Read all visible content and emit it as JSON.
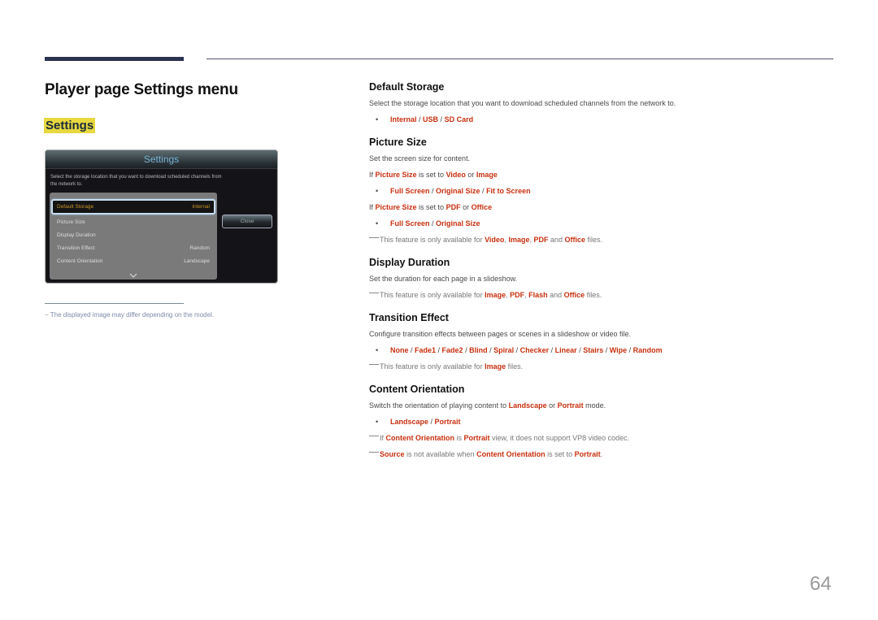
{
  "page": {
    "title": "Player page Settings menu",
    "section_chip": "Settings",
    "page_number": "64",
    "footnote": "The displayed image may differ depending on the model.",
    "footnote_marker": "−"
  },
  "osd": {
    "title": "Settings",
    "description": "Select the storage location that you want to download scheduled channels from the network to.",
    "rows": [
      {
        "label": "Default Storage",
        "value": "Internal",
        "selected": true
      },
      {
        "label": "Picture Size",
        "value": ""
      },
      {
        "label": "Display Duration",
        "value": ""
      },
      {
        "label": "Transition Effect",
        "value": "Random"
      },
      {
        "label": "Content Orientation",
        "value": "Landscape"
      }
    ],
    "scroll_icon": "chevron-down-icon",
    "close_label": "Close"
  },
  "colors": {
    "accent": "#c8300f",
    "chip": "#e7d840",
    "bar": "#2c3350"
  },
  "sections": {
    "default_storage": {
      "heading": "Default Storage",
      "desc": "Select the storage location that you want to download scheduled channels from the network to.",
      "options": [
        "Internal",
        "USB",
        "SD Card"
      ]
    },
    "picture_size": {
      "heading": "Picture Size",
      "desc": "Set the screen size for content.",
      "cond1": {
        "pre": "If ",
        "k1": "Picture Size",
        "mid": " is set to ",
        "k2": "Video",
        "or": " or ",
        "k3": "Image"
      },
      "options1": [
        "Full Screen",
        "Original Size",
        "Fit to Screen"
      ],
      "cond2": {
        "pre": "If ",
        "k1": "Picture Size",
        "mid": " is set to ",
        "k2": "PDF",
        "or": " or ",
        "k3": "Office"
      },
      "options2": [
        "Full Screen",
        "Original Size"
      ],
      "note": {
        "pre": "This feature is only available for ",
        "k1": "Video",
        "s1": ", ",
        "k2": "Image",
        "s2": ", ",
        "k3": "PDF",
        "s3": " and ",
        "k4": "Office",
        "post": " files."
      }
    },
    "display_duration": {
      "heading": "Display Duration",
      "desc": "Set the duration for each page in a slideshow.",
      "note": {
        "pre": "This feature is only available for ",
        "k1": "Image",
        "s1": ", ",
        "k2": "PDF",
        "s2": ", ",
        "k3": "Flash",
        "s3": " and ",
        "k4": "Office",
        "post": " files."
      }
    },
    "transition_effect": {
      "heading": "Transition Effect",
      "desc": "Configure transition effects between pages or scenes in a slideshow or video file.",
      "options": [
        "None",
        "Fade1",
        "Fade2",
        "Blind",
        "Spiral",
        "Checker",
        "Linear",
        "Stairs",
        "Wipe",
        "Random"
      ],
      "note": {
        "pre": "This feature is only available for ",
        "k1": "Image",
        "post": " files."
      }
    },
    "content_orientation": {
      "heading": "Content Orientation",
      "desc": {
        "pre": "Switch the orientation of playing content to ",
        "k1": "Landscape",
        "mid": " or ",
        "k2": "Portrait",
        "post": " mode."
      },
      "options": [
        "Landscape",
        "Portrait"
      ],
      "note1": {
        "pre": "If ",
        "k1": "Content Orientation",
        "mid": " is ",
        "k2": "Portrait",
        "post": " view, it does not support VP8 video codec."
      },
      "note2": {
        "k1": "Source",
        "mid": " is not available when ",
        "k2": "Content Orientation",
        "mid2": " is set to ",
        "k3": "Portrait",
        "post": "."
      }
    }
  }
}
